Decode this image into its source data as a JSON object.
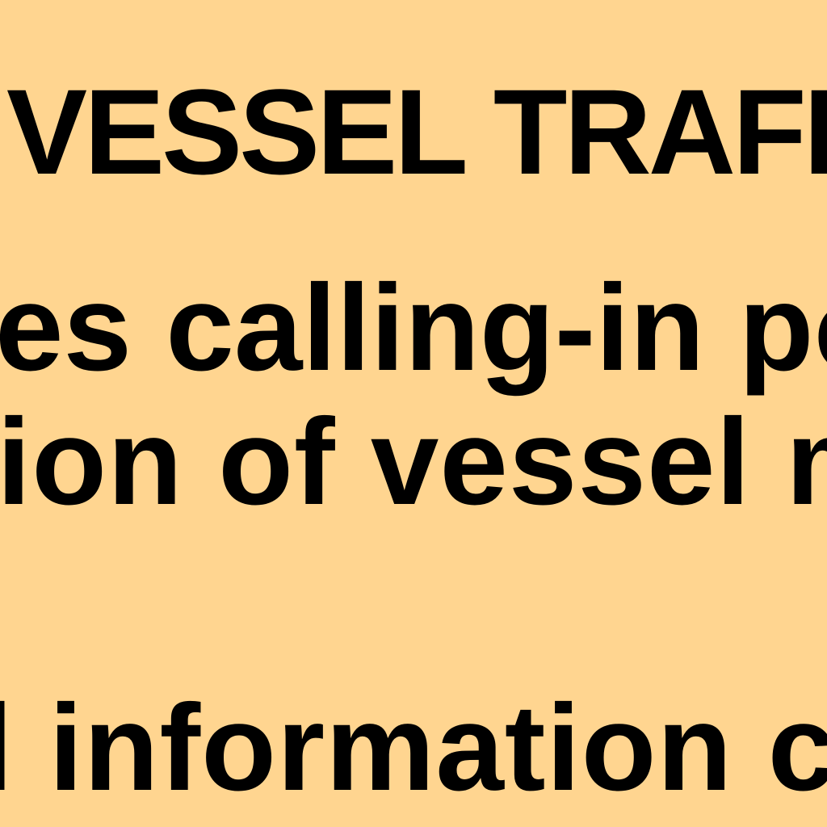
{
  "colors": {
    "background": "#FFD590",
    "text": "#000000"
  },
  "document": {
    "heading": "VESSEL TRAFFI",
    "lines": [
      "es calling-in poi",
      "ion of vessel m",
      "l information c"
    ]
  }
}
